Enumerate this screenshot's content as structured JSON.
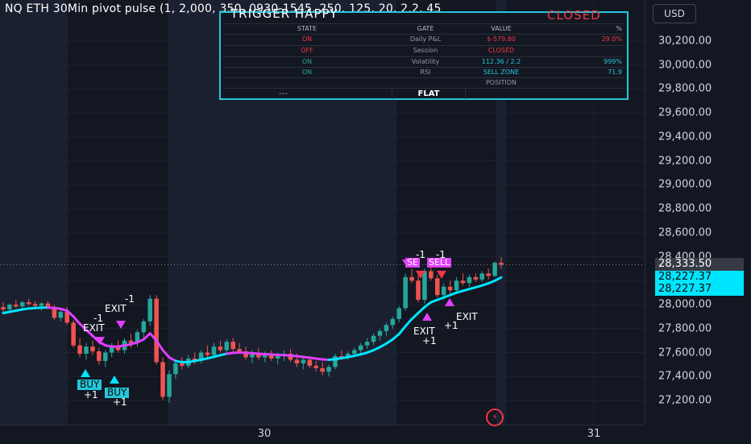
{
  "header": {
    "title": "NQ ETH 30Min pivot pulse (1, 2,000, 350, 0930-1545, 250, 125, 20, 2.2, 45",
    "currency": "USD"
  },
  "colors": {
    "background": "#131722",
    "session_band": "#1a2030",
    "up_candle": "#26a69a",
    "down_candle": "#ef5350",
    "ma_line": "#00e5ff",
    "ma_bear": "#e040fb",
    "accent_red": "#f23645"
  },
  "price_tags": {
    "last": "28,333.50",
    "ma_1": "28,227.37",
    "ma_2": "28,227.37"
  },
  "status_table": {
    "title_left": "TRIGGER HAPPY",
    "title_right": "CLOSED",
    "headers": [
      "STATE",
      "GATE",
      "VALUE",
      "%"
    ],
    "rows": [
      [
        "ON",
        "Daily P&L",
        "$-579.80",
        "29.0%"
      ],
      [
        "OFF",
        "Session",
        "CLOSED",
        ""
      ],
      [
        "ON",
        "Volatility",
        "112.36 / 2.2",
        "999%"
      ],
      [
        "ON",
        "RSI",
        "SELL ZONE",
        "71.9"
      ]
    ],
    "position_label": "POSITION",
    "position_left": "---",
    "position_value": "FLAT"
  },
  "signals": {
    "exit_labels": [
      "-1",
      "EXIT",
      "-1",
      "EXIT",
      "-1",
      "-1",
      "EXIT",
      "+1",
      "EXIT",
      "+1"
    ],
    "buy": [
      "BUY",
      "BUY"
    ],
    "buy_sub": [
      "+1",
      "+1"
    ],
    "sell": [
      "SE",
      "SELL"
    ]
  },
  "logo_icon": "tradingview-bolt-icon",
  "chart_data": {
    "type": "candlestick",
    "title": "",
    "ylim": [
      27100,
      30350
    ],
    "y_ticks": [
      "30,200.00",
      "30,000.00",
      "29,800.00",
      "29,600.00",
      "29,400.00",
      "29,200.00",
      "29,000.00",
      "28,800.00",
      "28,600.00",
      "28,400.00",
      "28,200.00",
      "28,000.00",
      "27,800.00",
      "27,600.00",
      "27,400.00",
      "27,200.00"
    ],
    "x_ticks": [
      {
        "label": "30"
      },
      {
        "label": "31"
      }
    ],
    "grid": true,
    "series": [
      {
        "name": "",
        "type": "ohlc",
        "ohlc": [
          [
            27980,
            28020,
            27930,
            27960
          ],
          [
            27960,
            28010,
            27940,
            28000
          ],
          [
            28000,
            28040,
            27970,
            27985
          ],
          [
            27985,
            28030,
            27960,
            28020
          ],
          [
            28020,
            28050,
            27990,
            28005
          ],
          [
            28005,
            28030,
            27970,
            27990
          ],
          [
            27990,
            28020,
            27950,
            28010
          ],
          [
            28010,
            28030,
            27960,
            27975
          ],
          [
            27975,
            28000,
            27870,
            27890
          ],
          [
            27890,
            27960,
            27860,
            27940
          ],
          [
            27940,
            27980,
            27830,
            27850
          ],
          [
            27850,
            27870,
            27640,
            27660
          ],
          [
            27660,
            27720,
            27560,
            27590
          ],
          [
            27590,
            27680,
            27540,
            27650
          ],
          [
            27650,
            27700,
            27580,
            27610
          ],
          [
            27610,
            27640,
            27500,
            27530
          ],
          [
            27530,
            27620,
            27480,
            27600
          ],
          [
            27600,
            27680,
            27560,
            27660
          ],
          [
            27660,
            27700,
            27600,
            27620
          ],
          [
            27620,
            27720,
            27590,
            27700
          ],
          [
            27700,
            27760,
            27640,
            27680
          ],
          [
            27680,
            27790,
            27650,
            27770
          ],
          [
            27770,
            27880,
            27700,
            27860
          ],
          [
            27860,
            28080,
            27820,
            28050
          ],
          [
            28050,
            28080,
            27500,
            27520
          ],
          [
            27520,
            27560,
            27200,
            27230
          ],
          [
            27230,
            27450,
            27180,
            27420
          ],
          [
            27420,
            27540,
            27380,
            27510
          ],
          [
            27510,
            27560,
            27460,
            27490
          ],
          [
            27490,
            27580,
            27470,
            27550
          ],
          [
            27550,
            27600,
            27500,
            27530
          ],
          [
            27530,
            27620,
            27510,
            27600
          ],
          [
            27600,
            27660,
            27560,
            27580
          ],
          [
            27580,
            27680,
            27560,
            27650
          ],
          [
            27650,
            27700,
            27600,
            27620
          ],
          [
            27620,
            27710,
            27590,
            27690
          ],
          [
            27690,
            27720,
            27610,
            27630
          ],
          [
            27630,
            27680,
            27590,
            27610
          ],
          [
            27610,
            27650,
            27540,
            27560
          ],
          [
            27560,
            27620,
            27510,
            27600
          ],
          [
            27600,
            27640,
            27540,
            27560
          ],
          [
            27560,
            27610,
            27520,
            27580
          ],
          [
            27580,
            27620,
            27530,
            27550
          ],
          [
            27550,
            27600,
            27500,
            27570
          ],
          [
            27570,
            27620,
            27530,
            27590
          ],
          [
            27590,
            27630,
            27520,
            27540
          ],
          [
            27540,
            27590,
            27480,
            27510
          ],
          [
            27510,
            27560,
            27460,
            27540
          ],
          [
            27540,
            27570,
            27470,
            27490
          ],
          [
            27490,
            27530,
            27440,
            27470
          ],
          [
            27470,
            27520,
            27410,
            27440
          ],
          [
            27440,
            27500,
            27400,
            27480
          ],
          [
            27480,
            27590,
            27460,
            27570
          ],
          [
            27570,
            27620,
            27540,
            27560
          ],
          [
            27560,
            27610,
            27540,
            27590
          ],
          [
            27590,
            27640,
            27560,
            27620
          ],
          [
            27620,
            27680,
            27580,
            27660
          ],
          [
            27660,
            27720,
            27630,
            27690
          ],
          [
            27690,
            27760,
            27660,
            27740
          ],
          [
            27740,
            27800,
            27700,
            27780
          ],
          [
            27780,
            27850,
            27740,
            27830
          ],
          [
            27830,
            27900,
            27800,
            27880
          ],
          [
            27880,
            27990,
            27850,
            27970
          ],
          [
            27970,
            28260,
            27950,
            28230
          ],
          [
            28230,
            28300,
            28180,
            28200
          ],
          [
            28200,
            28260,
            28020,
            28040
          ],
          [
            28040,
            28300,
            28010,
            28280
          ],
          [
            28280,
            28330,
            28200,
            28220
          ],
          [
            28220,
            28250,
            28060,
            28080
          ],
          [
            28080,
            28180,
            28040,
            28150
          ],
          [
            28150,
            28200,
            28090,
            28120
          ],
          [
            28120,
            28230,
            28090,
            28200
          ],
          [
            28200,
            28260,
            28160,
            28180
          ],
          [
            28180,
            28250,
            28150,
            28230
          ],
          [
            28230,
            28260,
            28190,
            28210
          ],
          [
            28210,
            28280,
            28190,
            28260
          ],
          [
            28260,
            28300,
            28210,
            28240
          ],
          [
            28240,
            28360,
            28230,
            28350
          ],
          [
            28350,
            28400,
            28300,
            28333
          ]
        ]
      },
      {
        "name": "",
        "type": "line",
        "values": [
          27930,
          27940,
          27950,
          27960,
          27968,
          27972,
          27975,
          27976,
          27972,
          27965,
          27950,
          27900,
          27840,
          27790,
          27740,
          27690,
          27660,
          27650,
          27650,
          27660,
          27670,
          27685,
          27710,
          27760,
          27700,
          27620,
          27560,
          27530,
          27520,
          27520,
          27530,
          27540,
          27552,
          27565,
          27578,
          27590,
          27598,
          27600,
          27598,
          27594,
          27590,
          27587,
          27584,
          27580,
          27578,
          27575,
          27570,
          27563,
          27557,
          27550,
          27543,
          27540,
          27545,
          27553,
          27562,
          27573,
          27585,
          27600,
          27620,
          27645,
          27675,
          27710,
          27755,
          27820,
          27880,
          27930,
          27980,
          28020,
          28040,
          28060,
          28080,
          28100,
          28115,
          28130,
          28145,
          28160,
          28178,
          28200,
          28227
        ]
      }
    ]
  }
}
